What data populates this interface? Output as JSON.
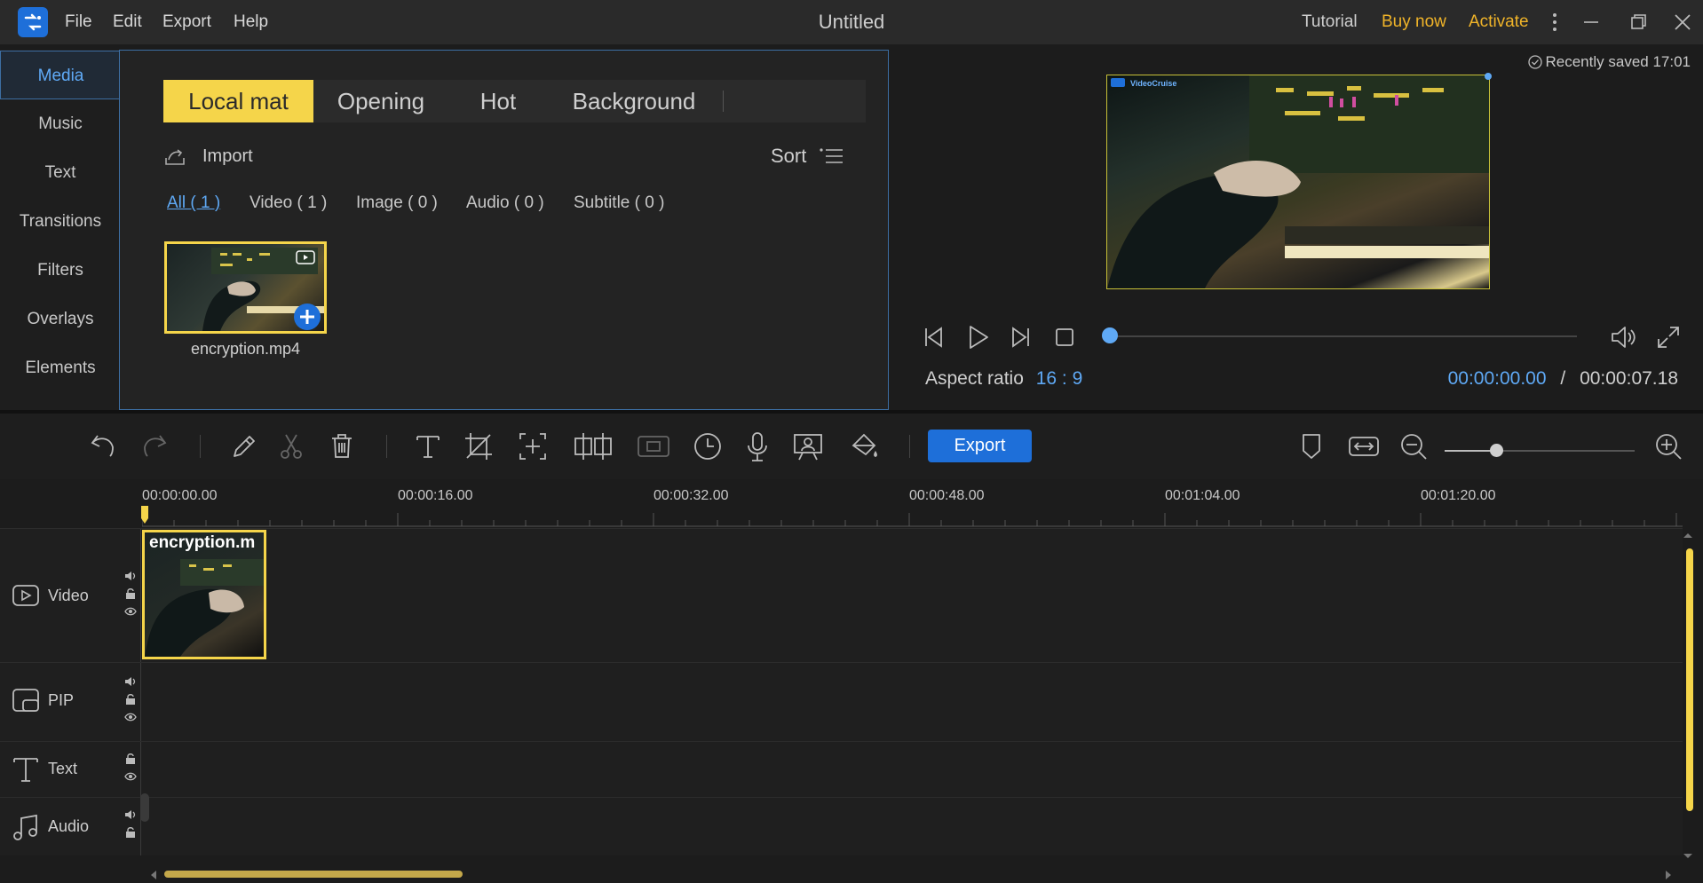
{
  "app": {
    "menu": [
      "File",
      "Edit",
      "Export",
      "Help"
    ],
    "title": "Untitled",
    "links": {
      "tutorial": "Tutorial",
      "buy": "Buy now",
      "activate": "Activate"
    }
  },
  "colors": {
    "accent": "#5fa9f5",
    "highlight": "#f5d54a",
    "brand": "#1e6fd9",
    "link": "#f0b429"
  },
  "side_nav": [
    "Media",
    "Music",
    "Text",
    "Transitions",
    "Filters",
    "Overlays",
    "Elements"
  ],
  "media": {
    "tabs": [
      "Local mat",
      "Opening",
      "Hot",
      "Background"
    ],
    "import_label": "Import",
    "sort_label": "Sort",
    "filters": [
      "All ( 1 )",
      "Video ( 1 )",
      "Image ( 0 )",
      "Audio ( 0 )",
      "Subtitle ( 0 )"
    ],
    "items": [
      {
        "name": "encryption.mp4"
      }
    ]
  },
  "preview": {
    "saved": "Recently saved 17:01",
    "badge": "VideoCruise",
    "aspect_label": "Aspect ratio",
    "aspect_value": "16 : 9",
    "time_current": "00:00:00.00",
    "time_sep": "/",
    "time_total": "00:00:07.18"
  },
  "toolbar": {
    "export_label": "Export"
  },
  "timeline": {
    "ruler": [
      "00:00:00.00",
      "00:00:16.00",
      "00:00:32.00",
      "00:00:48.00",
      "00:01:04.00",
      "00:01:20.00"
    ],
    "tracks": [
      "Video",
      "PIP",
      "Text",
      "Audio"
    ],
    "clip_title": "encryption.m"
  }
}
